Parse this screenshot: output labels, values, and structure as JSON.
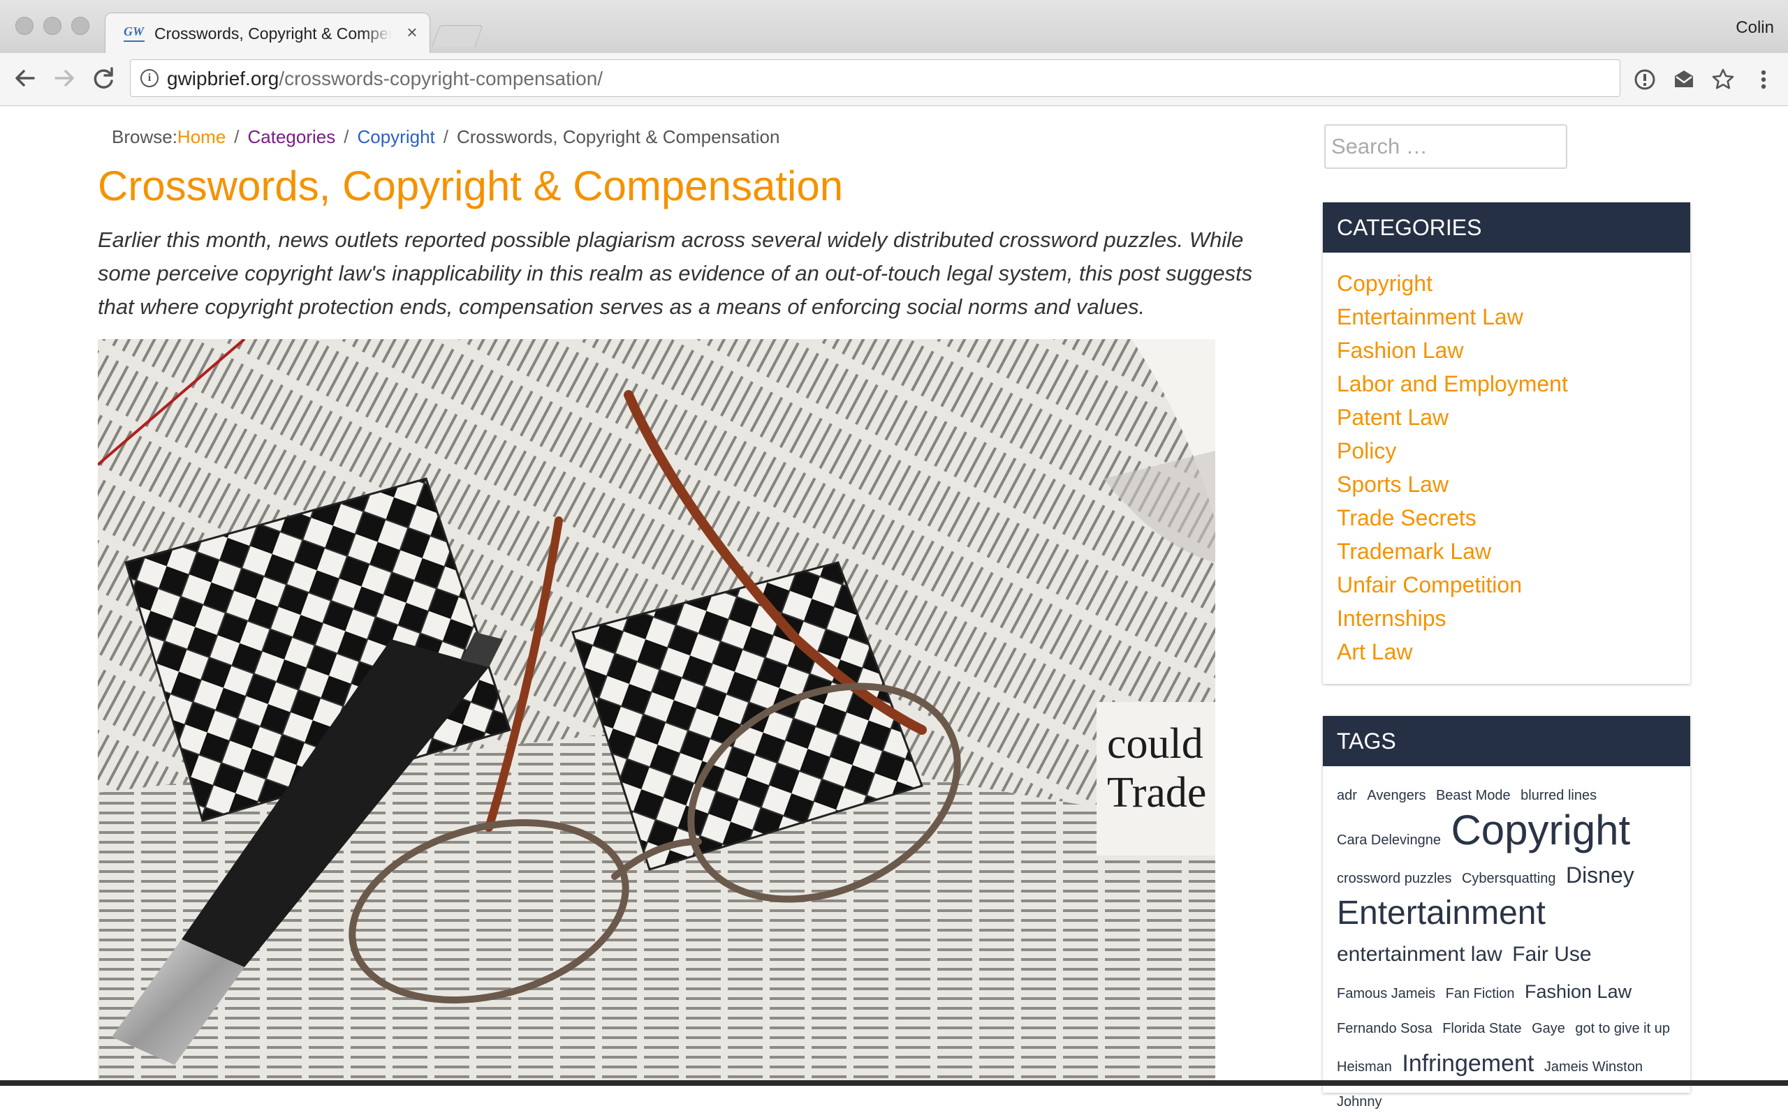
{
  "browser": {
    "tab_title": "Crosswords, Copyright & Compensation",
    "tab_favicon": "GW",
    "tab_close": "×",
    "user": "Colin",
    "url_domain": "gwipbrief.org",
    "url_path": "/crosswords-copyright-compensation/",
    "icons": [
      "back-arrow-icon",
      "forward-arrow-icon",
      "reload-icon",
      "info-icon",
      "extension-icon",
      "mail-icon",
      "star-icon",
      "menu-icon"
    ]
  },
  "breadcrumb": {
    "prefix": "Browse:",
    "home": "Home",
    "categories": "Categories",
    "copyright": "Copyright",
    "current": "Crosswords, Copyright & Compensation",
    "separator": "/"
  },
  "article": {
    "title": "Crosswords, Copyright & Compensation",
    "excerpt": "Earlier this month, news outlets reported possible plagiarism across several widely distributed crossword puzzles. While some perceive copyright law's inapplicability in this realm as evidence of an out-of-touch legal system, this post suggests that where copyright protection ends, compensation serves as a means of enforcing social norms and values."
  },
  "sidebar": {
    "search_placeholder": "Search …",
    "categories_heading": "CATEGORIES",
    "categories": [
      "Copyright",
      "Entertainment Law",
      "Fashion Law",
      "Labor and Employment",
      "Patent Law",
      "Policy",
      "Sports Law",
      "Trade Secrets",
      "Trademark Law",
      "Unfair Competition",
      "Internships",
      "Art Law"
    ],
    "tags_heading": "TAGS",
    "tags": [
      {
        "label": "adr",
        "size": 20
      },
      {
        "label": "Avengers",
        "size": 20
      },
      {
        "label": "Beast Mode",
        "size": 20
      },
      {
        "label": "blurred lines",
        "size": 20
      },
      {
        "label": "Cara Delevingne",
        "size": 20
      },
      {
        "label": "Copyright",
        "size": 60
      },
      {
        "label": "crossword puzzles",
        "size": 20
      },
      {
        "label": "Cybersquatting",
        "size": 20
      },
      {
        "label": "Disney",
        "size": 32
      },
      {
        "label": "Entertainment",
        "size": 48
      },
      {
        "label": "entertainment law",
        "size": 30
      },
      {
        "label": "Fair Use",
        "size": 30
      },
      {
        "label": "Famous Jameis",
        "size": 20
      },
      {
        "label": "Fan Fiction",
        "size": 20
      },
      {
        "label": "Fashion Law",
        "size": 27
      },
      {
        "label": "Fernando Sosa",
        "size": 20
      },
      {
        "label": "Florida State",
        "size": 20
      },
      {
        "label": "Gaye",
        "size": 20
      },
      {
        "label": "got to give it up",
        "size": 20
      },
      {
        "label": "Heisman",
        "size": 20
      },
      {
        "label": "Infringement",
        "size": 34
      },
      {
        "label": "Jameis Winston",
        "size": 20
      },
      {
        "label": "Johnny",
        "size": 20
      }
    ]
  },
  "colors": {
    "accent": "#f59200",
    "widget_header": "#253044",
    "categories_link": "#7a1c86",
    "copyright_link": "#2b5fc9"
  }
}
